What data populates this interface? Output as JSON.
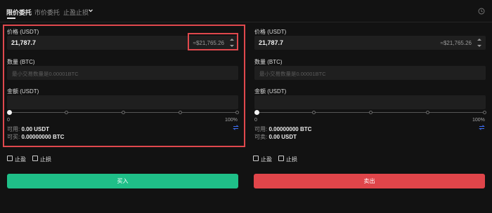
{
  "tabs": [
    {
      "label": "限价委托",
      "active": true
    },
    {
      "label": "市价委托",
      "active": false
    },
    {
      "label": "止盈止损",
      "active": false
    }
  ],
  "icons": {
    "dropdown": "chevron-down-icon",
    "history": "clock-icon",
    "stepper": "stepper-icon",
    "swap": "swap-icon"
  },
  "buy": {
    "price_label": "价格 (USDT)",
    "price_value": "21,787.7",
    "price_approx": "≈$21,765.26",
    "qty_label": "数量 (BTC)",
    "qty_placeholder": "最小交易数量是0.00001BTC",
    "amount_label": "金额 (USDT)",
    "amount_value": "",
    "slider_min": "0",
    "slider_max": "100%",
    "slider_value": 0,
    "available_label": "可用:",
    "available_value": "0.00 USDT",
    "can_trade_label": "可买:",
    "can_trade_value": "0.00000000 BTC",
    "take_profit_label": "止盈",
    "stop_loss_label": "止损",
    "button_label": "买入"
  },
  "sell": {
    "price_label": "价格 (USDT)",
    "price_value": "21,787.7",
    "price_approx": "≈$21,765.26",
    "qty_label": "数量 (BTC)",
    "qty_placeholder": "最小交易数量是0.00001BTC",
    "amount_label": "金额 (USDT)",
    "amount_value": "",
    "slider_min": "0",
    "slider_max": "100%",
    "slider_value": 0,
    "available_label": "可用:",
    "available_value": "0.00000000 BTC",
    "can_trade_label": "可卖:",
    "can_trade_value": "0.00 USDT",
    "take_profit_label": "止盈",
    "stop_loss_label": "止损",
    "button_label": "卖出"
  },
  "colors": {
    "buy": "#1fbf88",
    "sell": "#e0454a",
    "highlight": "#e0484d",
    "swap": "#3d6cf0",
    "background": "#121212"
  }
}
